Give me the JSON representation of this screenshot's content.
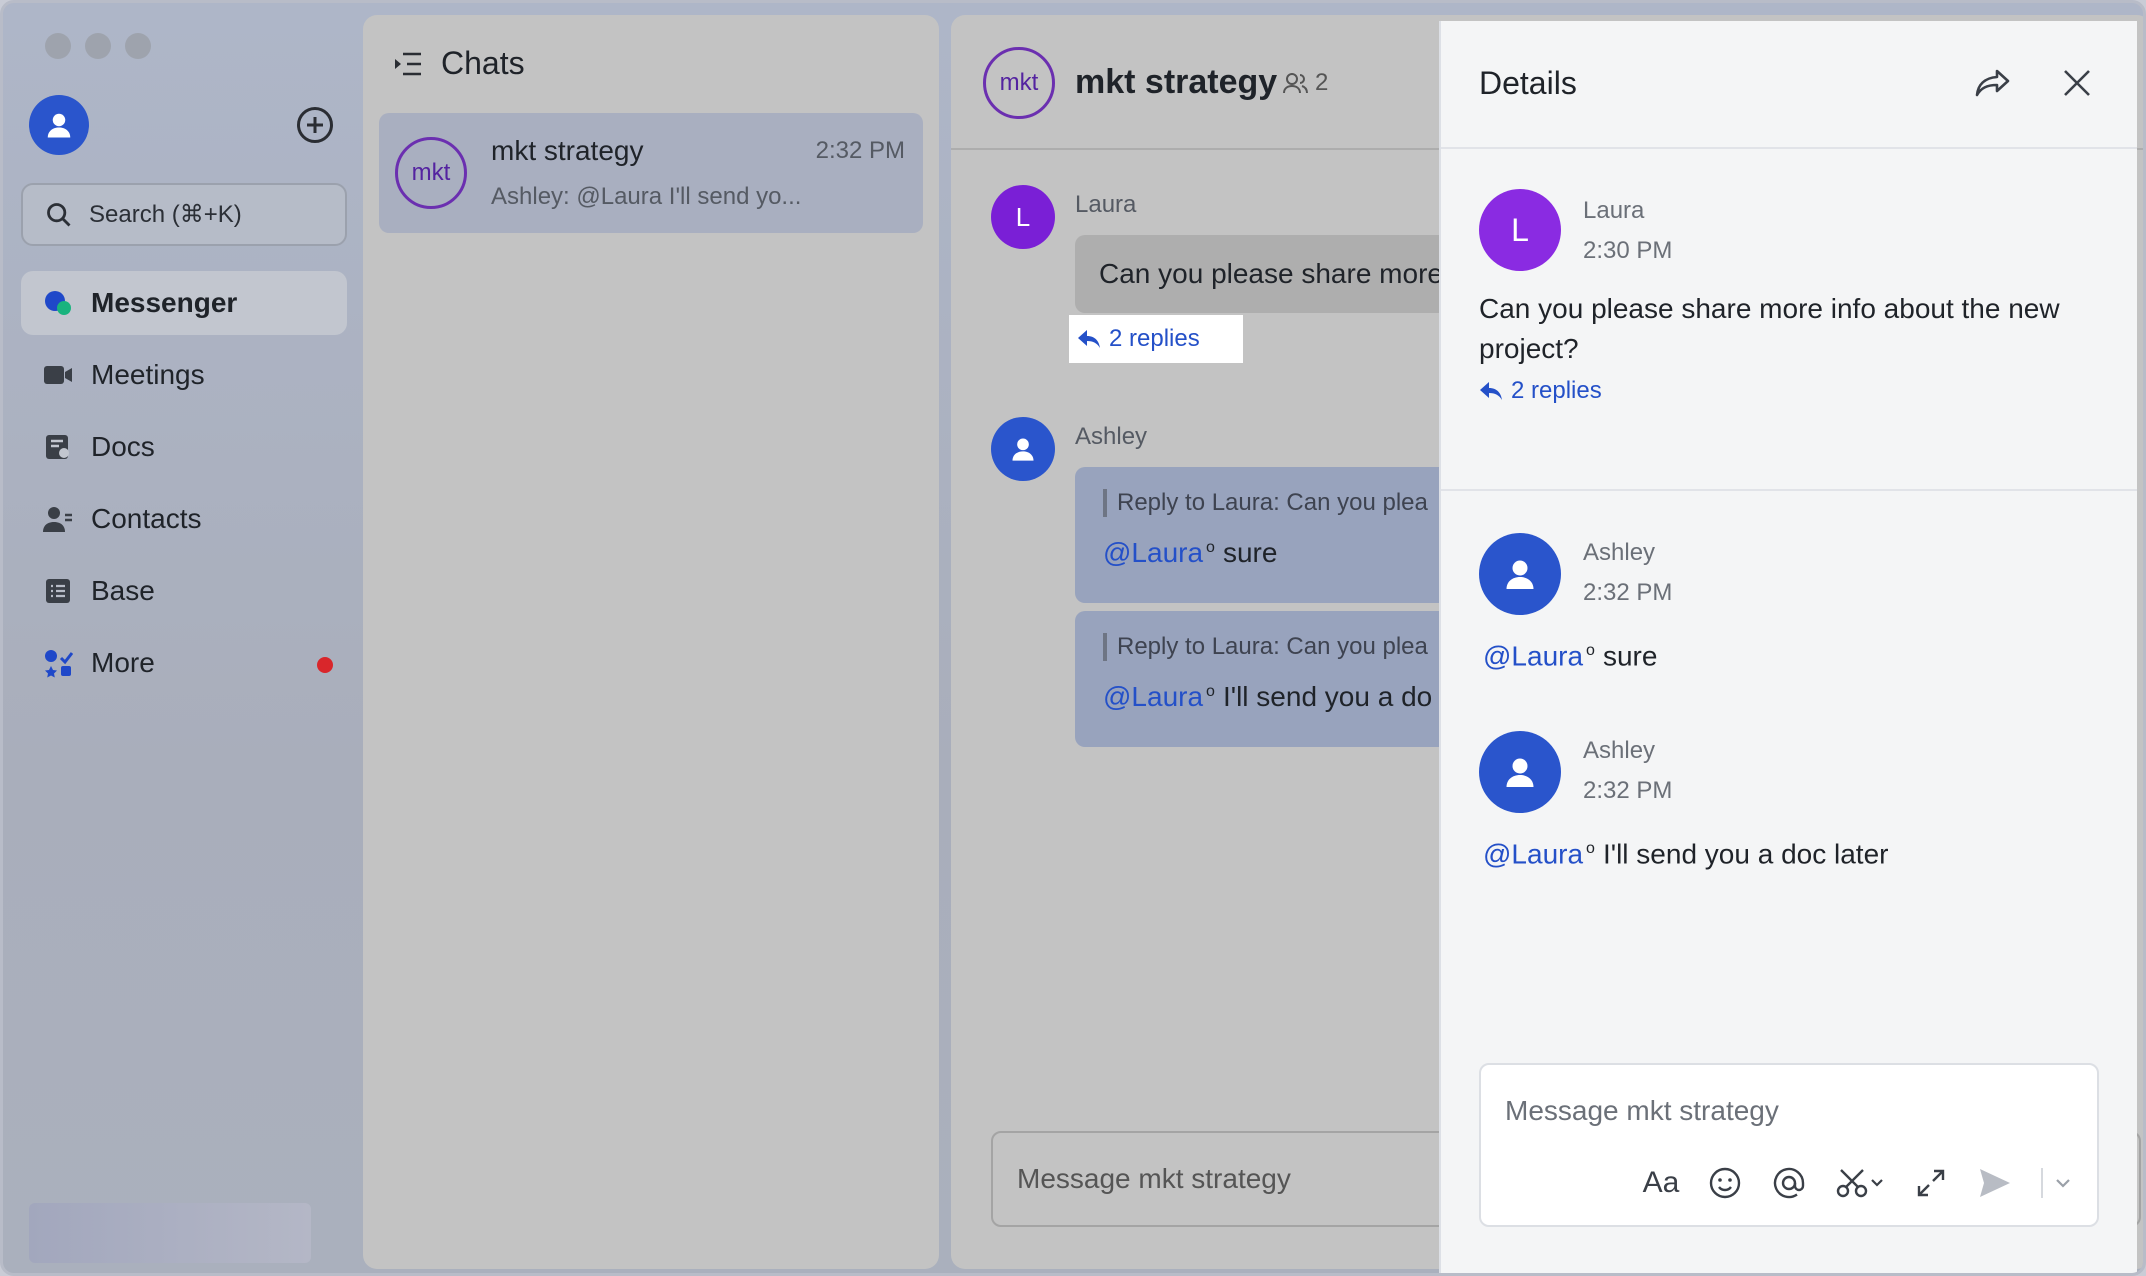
{
  "sidebar": {
    "search_placeholder": "Search (⌘+K)",
    "items": [
      {
        "label": "Messenger",
        "icon": "messenger-icon"
      },
      {
        "label": "Meetings",
        "icon": "video-camera-icon"
      },
      {
        "label": "Docs",
        "icon": "docs-icon"
      },
      {
        "label": "Contacts",
        "icon": "contacts-icon"
      },
      {
        "label": "Base",
        "icon": "base-icon"
      },
      {
        "label": "More",
        "icon": "apps-grid-icon"
      }
    ]
  },
  "chatlist": {
    "title": "Chats",
    "chats": [
      {
        "avatar": "mkt",
        "name": "mkt strategy",
        "time": "2:32 PM",
        "preview": "Ashley: @Laura I'll send yo..."
      }
    ]
  },
  "main": {
    "avatar": "mkt",
    "title": "mkt strategy",
    "member_count": "2",
    "messages": [
      {
        "initial": "L",
        "sender": "Laura",
        "text": "Can you please share more",
        "replies": "2 replies"
      },
      {
        "sender": "Ashley",
        "quote": "Reply to Laura:  Can you plea",
        "mention": "@Laura",
        "text": "sure"
      },
      {
        "quote": "Reply to Laura:  Can you plea",
        "mention": "@Laura",
        "text": "I'll send you a do"
      }
    ],
    "input_placeholder": "Message mkt strategy"
  },
  "details": {
    "title": "Details",
    "root": {
      "initial": "L",
      "sender": "Laura",
      "time": "2:30 PM",
      "text": "Can you please share more info about the new project?",
      "replies": "2 replies"
    },
    "replies": [
      {
        "sender": "Ashley",
        "time": "2:32 PM",
        "mention": "@Laura",
        "text": "sure"
      },
      {
        "sender": "Ashley",
        "time": "2:32 PM",
        "mention": "@Laura",
        "text": "I'll send you a doc later"
      }
    ],
    "input_placeholder": "Message mkt strategy",
    "tools": {
      "format": "Aa"
    }
  },
  "colors": {
    "accent_blue": "#2a55cc",
    "link_blue": "#2450c8",
    "laura_purple": "#8a2be2",
    "mkt_purple": "#6b2fb0",
    "notification_red": "#d9262b"
  }
}
